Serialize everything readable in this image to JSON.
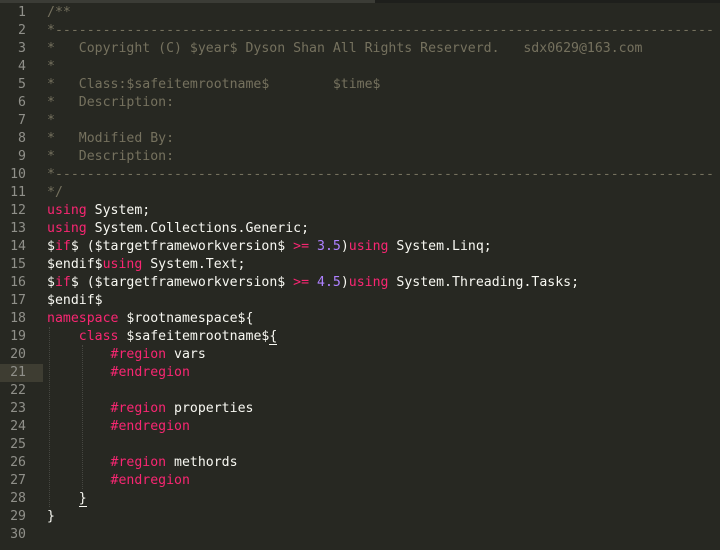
{
  "colors": {
    "background": "#272822",
    "gutter_text": "#90908a",
    "comment": "#75715e",
    "keyword": "#f92672",
    "number": "#ae81ff",
    "plain": "#f8f8f2",
    "current_line": "#3e3d32"
  },
  "editor": {
    "current_line": 21,
    "lines": [
      {
        "n": "1",
        "tokens": [
          {
            "t": "c",
            "v": "/**"
          }
        ]
      },
      {
        "n": "2",
        "tokens": [
          {
            "t": "c",
            "v": "*-----------------------------------------------------------------------------------"
          }
        ]
      },
      {
        "n": "3",
        "tokens": [
          {
            "t": "c",
            "v": "*   Copyright (C) $year$ Dyson Shan All Rights Reserverd.   sdx0629@163.com"
          }
        ]
      },
      {
        "n": "4",
        "tokens": [
          {
            "t": "c",
            "v": "*"
          }
        ]
      },
      {
        "n": "5",
        "tokens": [
          {
            "t": "c",
            "v": "*   Class:$safeitemrootname$        $time$"
          }
        ]
      },
      {
        "n": "6",
        "tokens": [
          {
            "t": "c",
            "v": "*   Description:"
          }
        ]
      },
      {
        "n": "7",
        "tokens": [
          {
            "t": "c",
            "v": "*"
          }
        ]
      },
      {
        "n": "8",
        "tokens": [
          {
            "t": "c",
            "v": "*   Modified By:"
          }
        ]
      },
      {
        "n": "9",
        "tokens": [
          {
            "t": "c",
            "v": "*   Description:"
          }
        ]
      },
      {
        "n": "10",
        "tokens": [
          {
            "t": "c",
            "v": "*-----------------------------------------------------------------------------------"
          }
        ]
      },
      {
        "n": "11",
        "tokens": [
          {
            "t": "c",
            "v": "*/"
          }
        ]
      },
      {
        "n": "12",
        "tokens": [
          {
            "t": "k",
            "v": "using"
          },
          {
            "t": "p",
            "v": " System;"
          }
        ]
      },
      {
        "n": "13",
        "tokens": [
          {
            "t": "k",
            "v": "using"
          },
          {
            "t": "p",
            "v": " System.Collections.Generic;"
          }
        ]
      },
      {
        "n": "14",
        "tokens": [
          {
            "t": "p",
            "v": "$"
          },
          {
            "t": "k",
            "v": "if"
          },
          {
            "t": "p",
            "v": "$ ($targetframeworkversion$ "
          },
          {
            "t": "k",
            "v": ">="
          },
          {
            "t": "p",
            "v": " "
          },
          {
            "t": "n",
            "v": "3.5"
          },
          {
            "t": "p",
            "v": ")"
          },
          {
            "t": "k",
            "v": "using"
          },
          {
            "t": "p",
            "v": " System.Linq;"
          }
        ]
      },
      {
        "n": "15",
        "tokens": [
          {
            "t": "p",
            "v": "$endif$"
          },
          {
            "t": "k",
            "v": "using"
          },
          {
            "t": "p",
            "v": " System.Text;"
          }
        ]
      },
      {
        "n": "16",
        "tokens": [
          {
            "t": "p",
            "v": "$"
          },
          {
            "t": "k",
            "v": "if"
          },
          {
            "t": "p",
            "v": "$ ($targetframeworkversion$ "
          },
          {
            "t": "k",
            "v": ">="
          },
          {
            "t": "p",
            "v": " "
          },
          {
            "t": "n",
            "v": "4.5"
          },
          {
            "t": "p",
            "v": ")"
          },
          {
            "t": "k",
            "v": "using"
          },
          {
            "t": "p",
            "v": " System.Threading.Tasks;"
          }
        ]
      },
      {
        "n": "17",
        "tokens": [
          {
            "t": "p",
            "v": "$endif$"
          }
        ]
      },
      {
        "n": "18",
        "tokens": [
          {
            "t": "k",
            "v": "namespace"
          },
          {
            "t": "p",
            "v": " $rootnamespace${"
          }
        ]
      },
      {
        "n": "19",
        "tokens": [
          {
            "t": "p",
            "v": "    "
          },
          {
            "t": "k",
            "v": "class"
          },
          {
            "t": "p",
            "v": " $safeitemrootname$"
          },
          {
            "t": "b",
            "v": "{"
          }
        ]
      },
      {
        "n": "20",
        "tokens": [
          {
            "t": "p",
            "v": "        "
          },
          {
            "t": "k",
            "v": "#region"
          },
          {
            "t": "p",
            "v": " vars"
          }
        ]
      },
      {
        "n": "21",
        "tokens": [
          {
            "t": "p",
            "v": "        "
          },
          {
            "t": "k",
            "v": "#endregion"
          }
        ]
      },
      {
        "n": "22",
        "tokens": []
      },
      {
        "n": "23",
        "tokens": [
          {
            "t": "p",
            "v": "        "
          },
          {
            "t": "k",
            "v": "#region"
          },
          {
            "t": "p",
            "v": " properties"
          }
        ]
      },
      {
        "n": "24",
        "tokens": [
          {
            "t": "p",
            "v": "        "
          },
          {
            "t": "k",
            "v": "#endregion"
          }
        ]
      },
      {
        "n": "25",
        "tokens": []
      },
      {
        "n": "26",
        "tokens": [
          {
            "t": "p",
            "v": "        "
          },
          {
            "t": "k",
            "v": "#region"
          },
          {
            "t": "p",
            "v": " methords"
          }
        ]
      },
      {
        "n": "27",
        "tokens": [
          {
            "t": "p",
            "v": "        "
          },
          {
            "t": "k",
            "v": "#endregion"
          }
        ]
      },
      {
        "n": "28",
        "tokens": [
          {
            "t": "p",
            "v": "    "
          },
          {
            "t": "b",
            "v": "}"
          }
        ]
      },
      {
        "n": "29",
        "tokens": [
          {
            "t": "p",
            "v": "}"
          }
        ]
      },
      {
        "n": "30",
        "tokens": []
      }
    ]
  }
}
